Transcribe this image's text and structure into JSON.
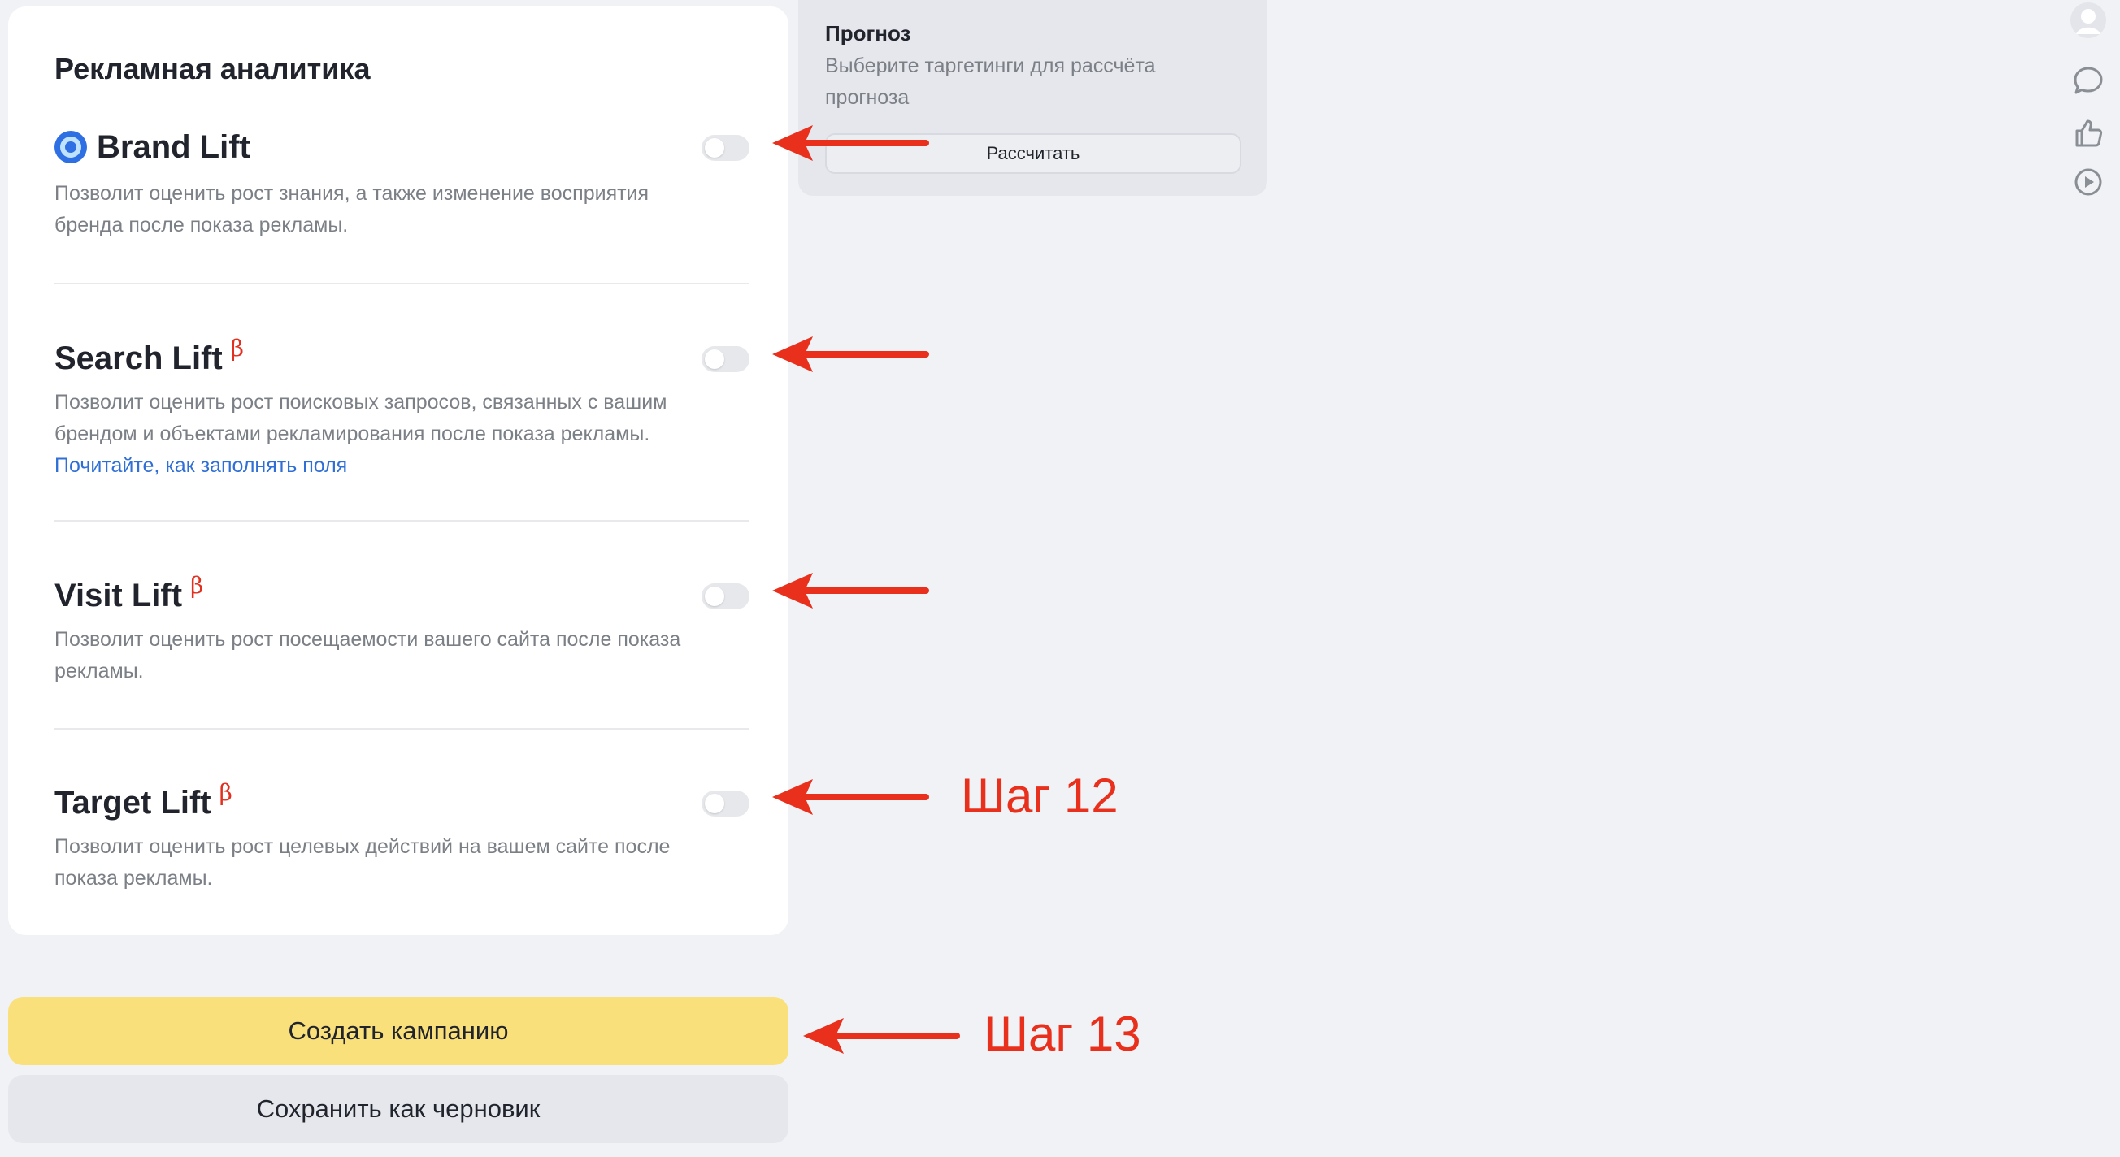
{
  "analytics": {
    "title": "Рекламная аналитика",
    "sections": [
      {
        "name": "Brand Lift",
        "beta": "",
        "toggle_on": false,
        "description": "Позволит оценить рост знания, а также изменение восприятия бренда после показа рекламы."
      },
      {
        "name": "Search Lift",
        "beta": "β",
        "toggle_on": false,
        "description": "Позволит оценить рост поисковых запросов, связанных с вашим брендом и объектами рекламирования после показа рекламы.",
        "link_text": "Почитайте, как заполнять поля"
      },
      {
        "name": "Visit Lift",
        "beta": "β",
        "toggle_on": false,
        "description": "Позволит оценить рост посещаемости вашего сайта после показа рекламы."
      },
      {
        "name": "Target Lift",
        "beta": "β",
        "toggle_on": false,
        "description": "Позволит оценить рост целевых действий на вашем сайте после показа рекламы."
      }
    ]
  },
  "forecast": {
    "title": "Прогноз",
    "text": "Выберите таргетинги для рассчёта прогноза",
    "button_label": "Рассчитать"
  },
  "actions": {
    "create_label": "Создать кампанию",
    "draft_label": "Сохранить как черновик"
  },
  "annotations": {
    "step12": "Шаг 12",
    "step13": "Шаг 13",
    "color": "#e8301c"
  },
  "side_icons": [
    "avatar-icon",
    "chat-icon",
    "thumbs-up-icon",
    "play-icon"
  ]
}
